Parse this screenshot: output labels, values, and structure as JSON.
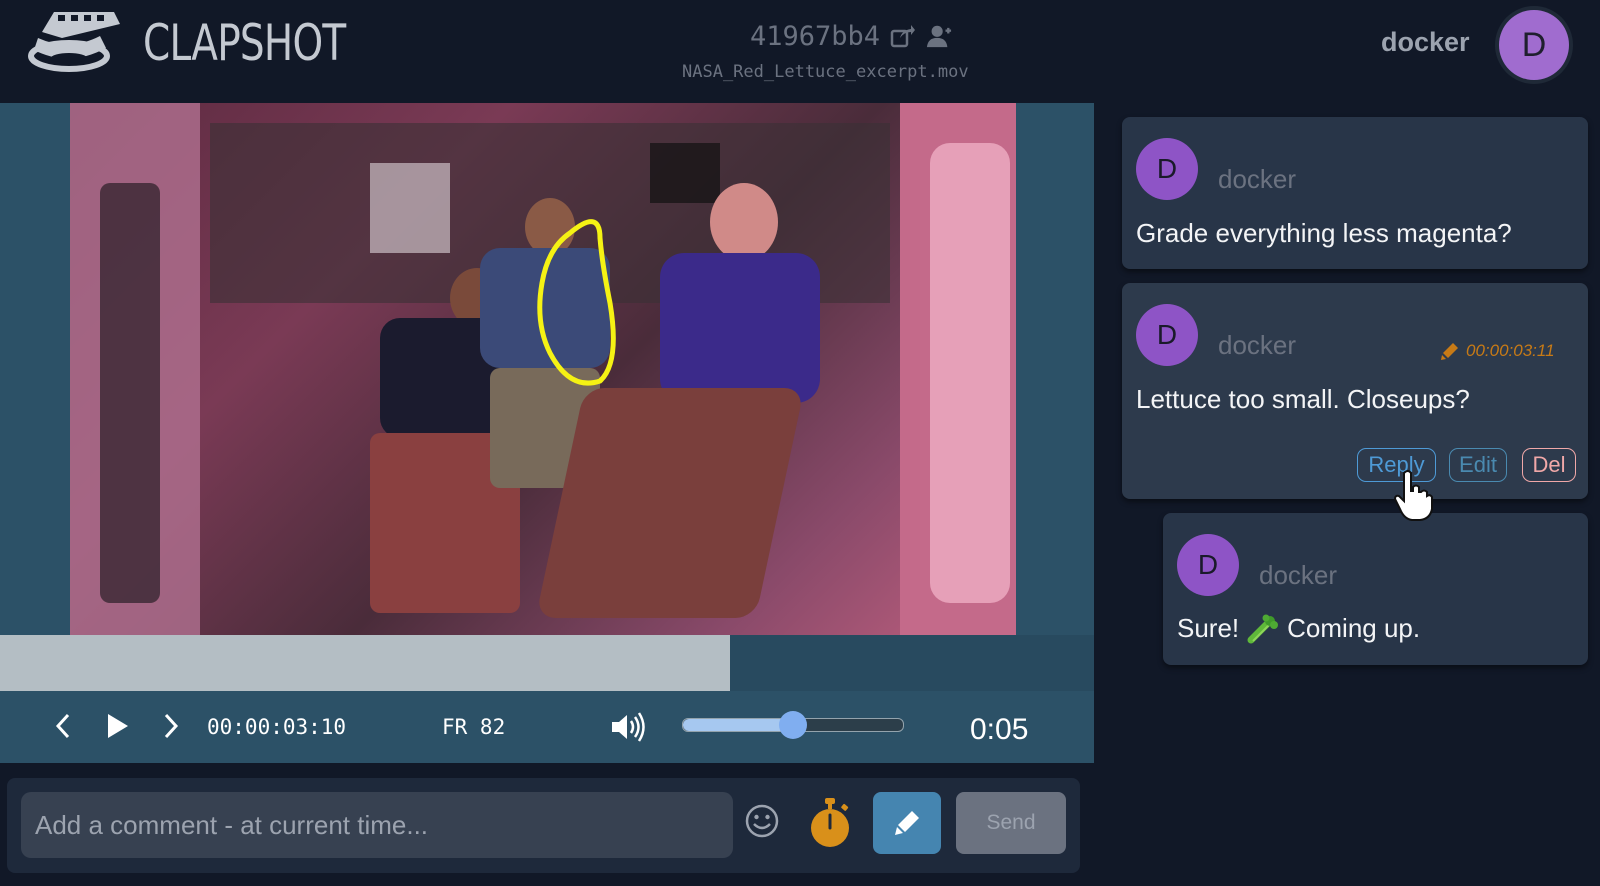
{
  "header": {
    "brand": "CLAPSHOT",
    "video_id": "41967bb4",
    "video_filename": "NASA_Red_Lettuce_excerpt.mov",
    "share_icon": "share-icon",
    "add_user_icon": "add-user-icon",
    "username": "docker",
    "avatar_letter": "D"
  },
  "player": {
    "progress_fraction": 0.667,
    "timecode": "00:00:03:10",
    "frame_label": "FR 82",
    "volume_fraction": 0.5,
    "duration": "0:05"
  },
  "comment_input": {
    "placeholder": "Add a comment - at current time...",
    "send_label": "Send"
  },
  "comments": [
    {
      "avatar_letter": "D",
      "username": "docker",
      "text": "Grade everything less magenta?"
    },
    {
      "avatar_letter": "D",
      "username": "docker",
      "timecode": "00:00:03:11",
      "text": "Lettuce too small. Closeups?",
      "actions": {
        "reply": "Reply",
        "edit": "Edit",
        "delete": "Del"
      }
    },
    {
      "avatar_letter": "D",
      "username": "docker",
      "text_before": "Sure!",
      "text_after": "Coming up."
    }
  ],
  "colors": {
    "background": "#111827",
    "player_bg": "#2c5167",
    "avatar": "#a06ccf",
    "timecode_accent": "#c77a16",
    "draw_button": "#4585b0"
  }
}
